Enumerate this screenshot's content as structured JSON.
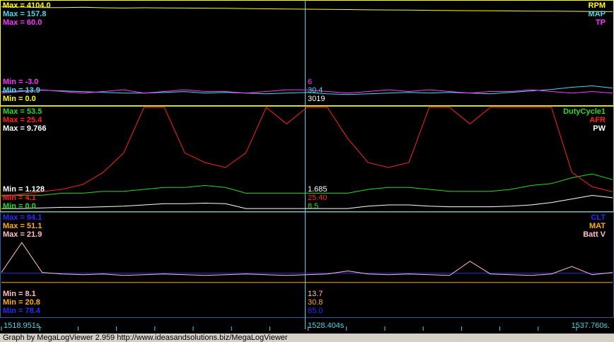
{
  "chart_data": [
    {
      "type": "line",
      "panel": "top",
      "series": [
        {
          "name": "RPM",
          "color": "#ffff00",
          "max_label": "Max = 4104.0",
          "min_label": "Min = 0.0",
          "cursor_value": "3019",
          "values": [
            3890,
            3880,
            3860,
            3860,
            3870,
            3850,
            3840,
            3850,
            3845,
            3840,
            3835,
            3830,
            3820,
            3810,
            3800,
            3795,
            3790,
            3780,
            3770,
            3765,
            3760,
            3750,
            3740,
            3735,
            3730,
            3725,
            3720,
            3715,
            3710,
            3705,
            3700
          ]
        },
        {
          "name": "MAP",
          "color": "#4dd7f0",
          "max_label": "Max = 157.8",
          "min_label": "Min = 13.9",
          "cursor_value": "30.4",
          "values": [
            32,
            33,
            34,
            33,
            32,
            31,
            30,
            30,
            31,
            32,
            30,
            31,
            30,
            29,
            30,
            31,
            29,
            28,
            29,
            30,
            31,
            30,
            31,
            30,
            29,
            31,
            33,
            35,
            38,
            40,
            37
          ]
        },
        {
          "name": "TP",
          "color": "#ff33ff",
          "max_label": "Max = 60.0",
          "min_label": "Min = -3.0",
          "cursor_value": "6",
          "values": [
            4,
            5,
            6,
            5,
            4,
            5,
            6,
            4,
            5,
            6,
            5,
            5,
            4,
            5,
            6,
            6,
            5,
            4,
            5,
            6,
            5,
            6,
            5,
            4,
            5,
            5,
            6,
            5,
            4,
            5,
            4
          ]
        }
      ]
    },
    {
      "type": "line",
      "panel": "middle",
      "series": [
        {
          "name": "DutyCycle1",
          "color": "#22dd22",
          "max_label": "Max = 53.5",
          "min_label": "Min = 0.0",
          "cursor_value": "8.5",
          "values": [
            8,
            8,
            8,
            9,
            9,
            10,
            10,
            11,
            12,
            12,
            13,
            12,
            9,
            9,
            9,
            9,
            9,
            9,
            11,
            12,
            12,
            11,
            10,
            10,
            10,
            11,
            13,
            14,
            17,
            19,
            16
          ]
        },
        {
          "name": "AFR",
          "color": "#ff2020",
          "max_label": "Max = 25.4",
          "min_label": "Min = 4.1",
          "cursor_value": "25.40",
          "values": [
            7,
            7.5,
            8,
            8.5,
            9.5,
            12,
            16,
            25.4,
            25.4,
            16,
            14,
            13,
            16,
            25.4,
            22,
            25.4,
            25.4,
            19,
            14,
            13,
            14,
            25.4,
            25.4,
            22,
            25.4,
            25.4,
            25.4,
            25.4,
            12,
            9,
            8
          ]
        },
        {
          "name": "PW",
          "color": "#ffffff",
          "max_label": "Max = 9.766",
          "min_label": "Min = 1.128",
          "cursor_value": "1.685",
          "values": [
            1.3,
            1.3,
            1.35,
            1.4,
            1.4,
            1.45,
            1.5,
            1.6,
            1.7,
            1.7,
            1.75,
            1.7,
            1.3,
            1.3,
            1.3,
            1.3,
            1.3,
            1.3,
            1.5,
            1.6,
            1.6,
            1.5,
            1.45,
            1.45,
            1.45,
            1.5,
            1.6,
            1.8,
            2.1,
            2.4,
            2.2
          ]
        }
      ]
    },
    {
      "type": "line",
      "panel": "bottom",
      "series": [
        {
          "name": "CLT",
          "color": "#2a2aff",
          "max_label": "Max = 94.1",
          "min_label": "Min = 78.4",
          "cursor_value": "85.0",
          "values": [
            85,
            85,
            85,
            85,
            85,
            85,
            85,
            85,
            85,
            85,
            85,
            85,
            85,
            85,
            85,
            85,
            85,
            85,
            85,
            85,
            85,
            85,
            85,
            85,
            85,
            85,
            85,
            85,
            85,
            85,
            85
          ]
        },
        {
          "name": "MAT",
          "color": "#ffb000",
          "max_label": "Max = 51.1",
          "min_label": "Min = 20.8",
          "cursor_value": "30.8",
          "values": [
            30.8,
            30.8,
            30.8,
            30.8,
            30.8,
            30.8,
            30.8,
            30.8,
            30.8,
            30.8,
            30.8,
            30.8,
            30.8,
            30.8,
            30.8,
            30.8,
            30.8,
            30.8,
            30.8,
            30.8,
            30.8,
            30.8,
            30.8,
            30.8,
            30.8,
            30.8,
            30.8,
            30.8,
            30.8,
            30.8,
            30.8
          ]
        },
        {
          "name": "Batt V",
          "color": "#ffc0c0",
          "max_label": "Max = 21.9",
          "min_label": "Min = 8.1",
          "cursor_value": "13.7",
          "values": [
            14,
            18,
            14,
            13.8,
            13.7,
            13.8,
            13.6,
            13.7,
            13.8,
            13.7,
            13.6,
            13.7,
            13.8,
            13.7,
            13.6,
            13.7,
            13.8,
            14.2,
            13.8,
            13.7,
            13.8,
            13.7,
            13.6,
            15.5,
            13.8,
            13.7,
            13.6,
            13.8,
            14.8,
            13.7,
            14
          ]
        }
      ]
    }
  ],
  "time_labels": {
    "start": "1518.951s.",
    "cursor": "1528.404s",
    "end": "1537.760s."
  },
  "footer": "Graph by MegaLogViewer 2.959 http://www.ideasandsolutions.biz/MegaLogViewer",
  "colors": {
    "panel1_border": "#ffff00",
    "panel2_border": "#4ad3e6",
    "panel3_border": "#4ad3e6",
    "cursor": "#4ad3e6"
  }
}
